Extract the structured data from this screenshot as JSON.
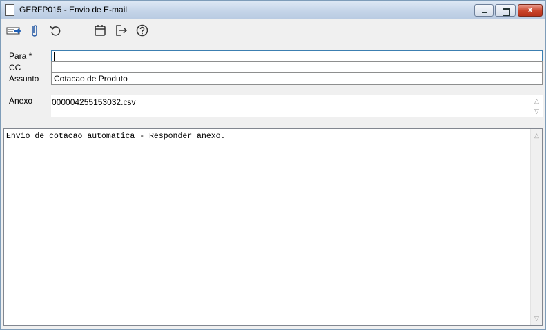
{
  "window": {
    "title": "GERFP015 - Envio de E-mail",
    "controls": [
      "minimize-icon",
      "maximize-icon",
      "close-icon"
    ],
    "close_glyph": "x"
  },
  "toolbar": {
    "buttons": [
      {
        "name": "send-email-button",
        "icon": "send-icon"
      },
      {
        "name": "attach-button",
        "icon": "paperclip-icon"
      },
      {
        "name": "undo-button",
        "icon": "undo-icon"
      },
      {
        "name": "calendar-button",
        "icon": "calendar-icon"
      },
      {
        "name": "exit-button",
        "icon": "exit-icon"
      },
      {
        "name": "help-button",
        "icon": "help-icon"
      }
    ]
  },
  "form": {
    "para_label": "Para *",
    "para_value": "",
    "cc_label": "CC",
    "cc_value": "",
    "assunto_label": "Assunto",
    "assunto_value": "Cotacao de Produto",
    "anexo_label": "Anexo",
    "anexo_value": "000004255153032.csv"
  },
  "message": {
    "body": "Envio de cotacao automatica - Responder anexo."
  },
  "colors": {
    "title_bar": "#c4d4e8",
    "close_button": "#c9442b",
    "window_bg": "#f0f0f0",
    "active_field_border": "#3c7fb1"
  }
}
